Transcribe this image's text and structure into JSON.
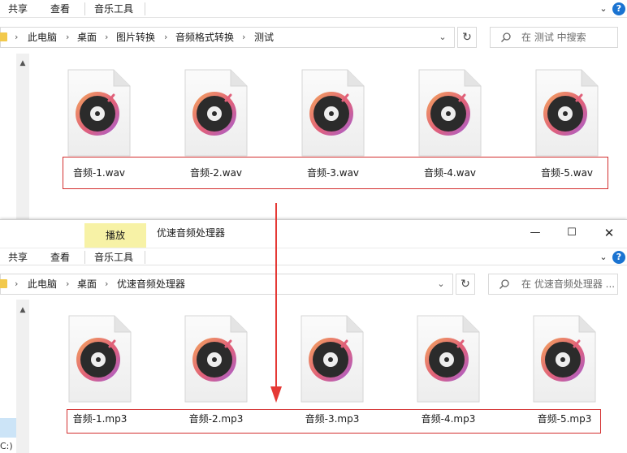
{
  "window1": {
    "ribbon": {
      "tabs": [
        "共享",
        "查看",
        "音乐工具"
      ]
    },
    "address": {
      "crumbs": [
        "此电脑",
        "桌面",
        "图片转换",
        "音频格式转换",
        "测试"
      ]
    },
    "search_placeholder": "在 测试 中搜索",
    "files": [
      {
        "name": "音频-1.wav"
      },
      {
        "name": "音频-2.wav"
      },
      {
        "name": "音频-3.wav"
      },
      {
        "name": "音频-4.wav"
      },
      {
        "name": "音频-5.wav"
      }
    ]
  },
  "window2": {
    "context_tab": "播放",
    "title": "优速音频处理器",
    "ribbon": {
      "tabs": [
        "共享",
        "查看",
        "音乐工具"
      ]
    },
    "address": {
      "crumbs": [
        "此电脑",
        "桌面",
        "优速音频处理器"
      ]
    },
    "search_placeholder": "在 优速音频处理器 ...",
    "files": [
      {
        "name": "音频-1.mp3"
      },
      {
        "name": "音频-2.mp3"
      },
      {
        "name": "音频-3.mp3"
      },
      {
        "name": "音频-4.mp3"
      },
      {
        "name": "音频-5.mp3"
      }
    ],
    "drive_label": "C:)"
  },
  "colors": {
    "highlight": "#d32f2f",
    "arrow": "#e53935",
    "context_tab_bg": "#f7f2a6",
    "help": "#1a73d1",
    "folder": "#f2c94c"
  },
  "icons": {
    "file": "music-file-icon",
    "search": "search-icon",
    "refresh": "refresh-icon",
    "folder": "folder-icon",
    "help": "help-icon"
  }
}
